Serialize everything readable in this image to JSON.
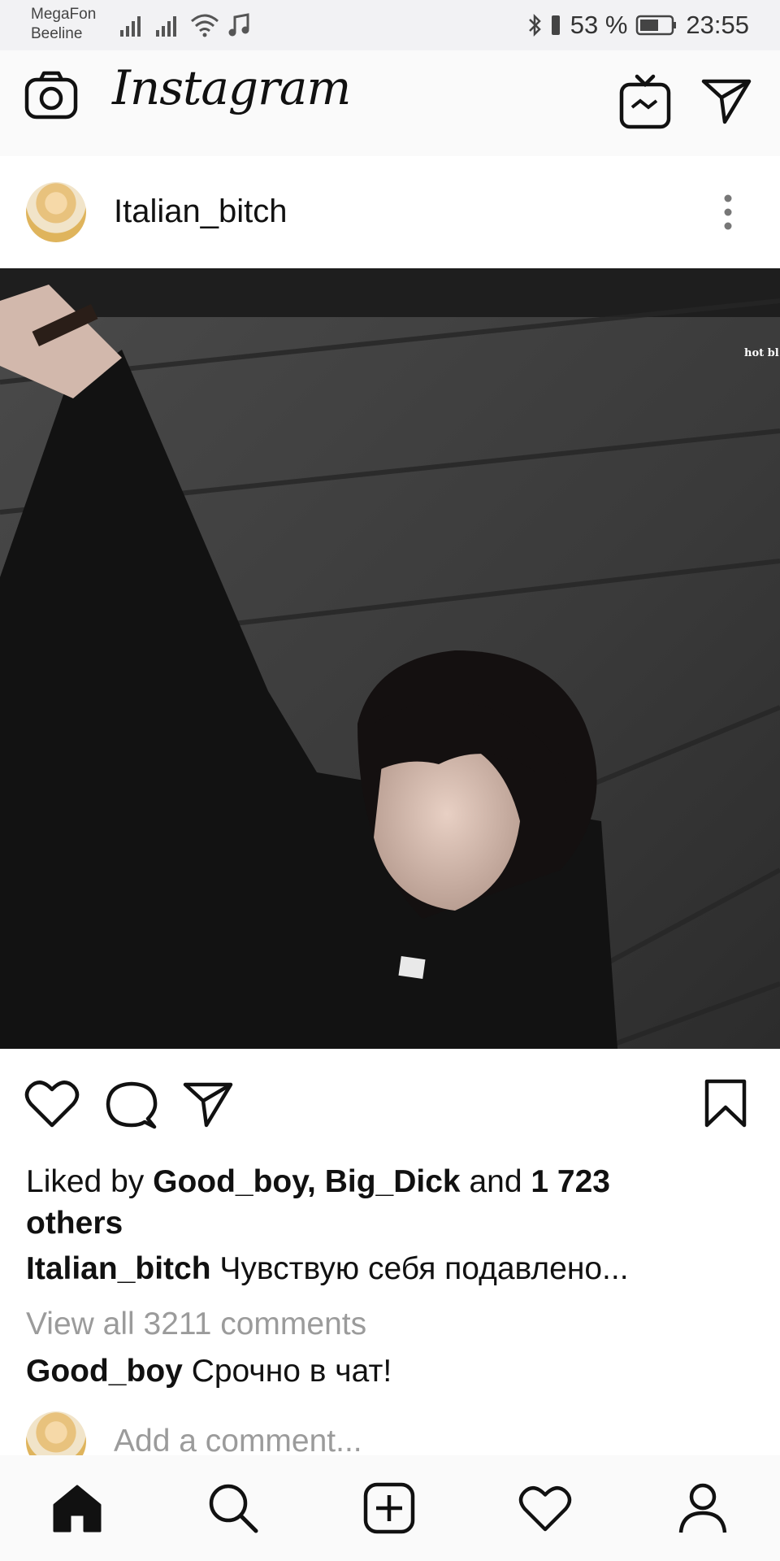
{
  "status_bar": {
    "carrier_1": "MegaFon",
    "carrier_2": "Beeline",
    "battery_percent": "53 %",
    "time": "23:55",
    "icons": [
      "signal-icon",
      "signal-icon",
      "wifi-icon",
      "music-icon",
      "bluetooth-icon",
      "vibrate-icon",
      "battery-icon"
    ]
  },
  "app": {
    "logo_text": "Instagram",
    "header_icons": [
      "camera-icon",
      "igtv-icon",
      "direct-message-icon"
    ]
  },
  "post": {
    "username": "Italian_bitch",
    "overlay_text": "hot bl",
    "likes": {
      "prefix": "Liked by ",
      "users": "Good_boy, Big_Dick",
      "connector": " and ",
      "count": "1 723 others"
    },
    "caption": {
      "username": "Italian_bitch",
      "text": "Чувствую себя подавлено..."
    },
    "view_all_comments": "View all 3211 comments",
    "top_comment": {
      "username": "Good_boy",
      "text": "Срочно в чат!"
    },
    "add_comment_placeholder": "Add a comment..."
  },
  "bottom_nav": {
    "items": [
      "home-icon",
      "search-icon",
      "new-post-icon",
      "activity-icon",
      "profile-icon"
    ],
    "active": "home-icon"
  }
}
